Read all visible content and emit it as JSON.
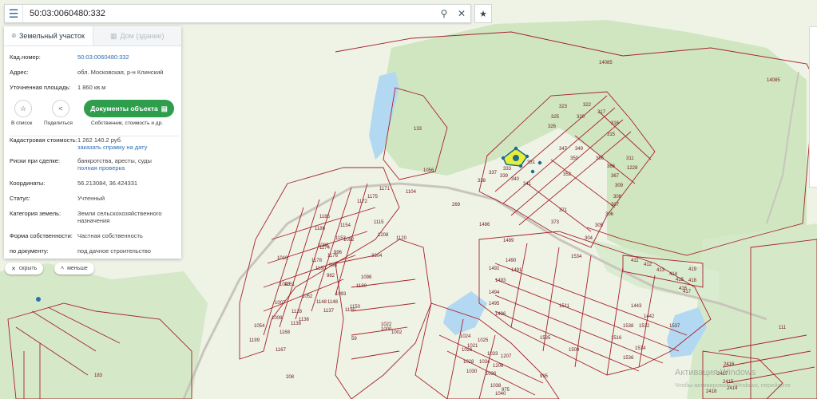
{
  "search": {
    "value": "50:03:0060480:332",
    "placeholder": ""
  },
  "tabs": [
    {
      "label": "Земельный участок"
    },
    {
      "label": "Дом (здание)"
    }
  ],
  "info": {
    "cad_label": "Кад.номер:",
    "cad_value": "50:03:0060480:332",
    "addr_label": "Адрес:",
    "addr_value": "обл. Московская, р-н Клинский",
    "area_label": "Уточненная площадь:",
    "area_value": "1 860 кв.м",
    "cost_label": "Кадастровая стоимость:",
    "cost_value": "1 262 140.2 руб.",
    "cost_link": "заказать справку на дату",
    "risk_label": "Риски при сделке:",
    "risk_value": "банкротства, аресты, суды",
    "risk_link": "полная проверка",
    "coord_label": "Координаты:",
    "coord_value": "56.213084, 36.424331",
    "status_label": "Статус:",
    "status_value": "Учтенный",
    "cat_label": "Категория земель:",
    "cat_value": "Земли сельскохозяйственного назначения",
    "own_label": "Форма собственности:",
    "own_value": "Частная собственность",
    "doc_label": "по документу:",
    "doc_value": "под дачное строительство"
  },
  "actions": {
    "fav": "В список",
    "share": "Поделиться",
    "docs_button": "Документы объекта",
    "docs_sub": "Собственник, стоимость и др."
  },
  "pills": {
    "hide": "скрыть",
    "less": "меньше"
  },
  "watermark": {
    "line1": "Активация Windows",
    "line2": "Чтобы активировать Windows, перейдите"
  },
  "map_labels": [
    {
      "t": "14085"
    },
    {
      "t": "14085"
    },
    {
      "t": "133"
    },
    {
      "t": "1056"
    },
    {
      "t": "337"
    },
    {
      "t": "333"
    },
    {
      "t": "331"
    },
    {
      "t": "311"
    },
    {
      "t": "323"
    },
    {
      "t": "322"
    },
    {
      "t": "317"
    },
    {
      "t": "325"
    },
    {
      "t": "320"
    },
    {
      "t": "316"
    },
    {
      "t": "326"
    },
    {
      "t": "315"
    },
    {
      "t": "347"
    },
    {
      "t": "349"
    },
    {
      "t": "350"
    },
    {
      "t": "352"
    },
    {
      "t": "356"
    },
    {
      "t": "366"
    },
    {
      "t": "367"
    },
    {
      "t": "309"
    },
    {
      "t": "308"
    },
    {
      "t": "307"
    },
    {
      "t": "306"
    },
    {
      "t": "305"
    },
    {
      "t": "304"
    },
    {
      "t": "371"
    },
    {
      "t": "373"
    },
    {
      "t": "1228"
    },
    {
      "t": "1486"
    },
    {
      "t": "1489"
    },
    {
      "t": "1490"
    },
    {
      "t": "1491"
    },
    {
      "t": "1492"
    },
    {
      "t": "1493"
    },
    {
      "t": "1494"
    },
    {
      "t": "1495"
    },
    {
      "t": "1496"
    },
    {
      "t": "1511"
    },
    {
      "t": "1509"
    },
    {
      "t": "1535"
    },
    {
      "t": "1532"
    },
    {
      "t": "1537"
    },
    {
      "t": "1442"
    },
    {
      "t": "1443"
    },
    {
      "t": "1534"
    },
    {
      "t": "1536"
    },
    {
      "t": "1516"
    },
    {
      "t": "1514"
    },
    {
      "t": "1538"
    },
    {
      "t": "1185"
    },
    {
      "t": "1186"
    },
    {
      "t": "1154"
    },
    {
      "t": "1153"
    },
    {
      "t": "1151"
    },
    {
      "t": "1148"
    },
    {
      "t": "1052"
    },
    {
      "t": "1043"
    },
    {
      "t": "1007"
    },
    {
      "t": "1008"
    },
    {
      "t": "1010"
    },
    {
      "t": "1054"
    },
    {
      "t": "1199"
    },
    {
      "t": "1167"
    },
    {
      "t": "1168"
    },
    {
      "t": "1138"
    },
    {
      "t": "1136"
    },
    {
      "t": "1128"
    },
    {
      "t": "1130"
    },
    {
      "t": "1098"
    },
    {
      "t": "982"
    },
    {
      "t": "998"
    },
    {
      "t": "996"
    },
    {
      "t": "1171"
    },
    {
      "t": "1172"
    },
    {
      "t": "1175"
    },
    {
      "t": "1104"
    },
    {
      "t": "1208"
    },
    {
      "t": "1120"
    },
    {
      "t": "1115"
    },
    {
      "t": "1083"
    },
    {
      "t": "1092"
    },
    {
      "t": "3304"
    },
    {
      "t": "1022"
    },
    {
      "t": "1024"
    },
    {
      "t": "1026"
    },
    {
      "t": "1028"
    },
    {
      "t": "1030"
    },
    {
      "t": "1034"
    },
    {
      "t": "1036"
    },
    {
      "t": "1038"
    },
    {
      "t": "1040"
    },
    {
      "t": "975"
    },
    {
      "t": "995"
    },
    {
      "t": "1206"
    },
    {
      "t": "1207"
    },
    {
      "t": "1021"
    },
    {
      "t": "1025"
    },
    {
      "t": "1033"
    },
    {
      "t": "411"
    },
    {
      "t": "412"
    },
    {
      "t": "413"
    },
    {
      "t": "414"
    },
    {
      "t": "415"
    },
    {
      "t": "416"
    },
    {
      "t": "417"
    },
    {
      "t": "418"
    },
    {
      "t": "419"
    },
    {
      "t": "111"
    },
    {
      "t": "183"
    },
    {
      "t": "208"
    },
    {
      "t": "2418"
    },
    {
      "t": "2417"
    },
    {
      "t": "2416"
    },
    {
      "t": "2415"
    },
    {
      "t": "2414"
    },
    {
      "t": "59"
    },
    {
      "t": "1148"
    },
    {
      "t": "1150"
    },
    {
      "t": "1137"
    },
    {
      "t": "1093"
    },
    {
      "t": "1174"
    },
    {
      "t": "1176"
    },
    {
      "t": "1178"
    },
    {
      "t": "1180"
    },
    {
      "t": "1190"
    },
    {
      "t": "269"
    },
    {
      "t": "1000"
    },
    {
      "t": "1002"
    },
    {
      "t": "338"
    },
    {
      "t": "339"
    },
    {
      "t": "340"
    },
    {
      "t": "341"
    }
  ]
}
